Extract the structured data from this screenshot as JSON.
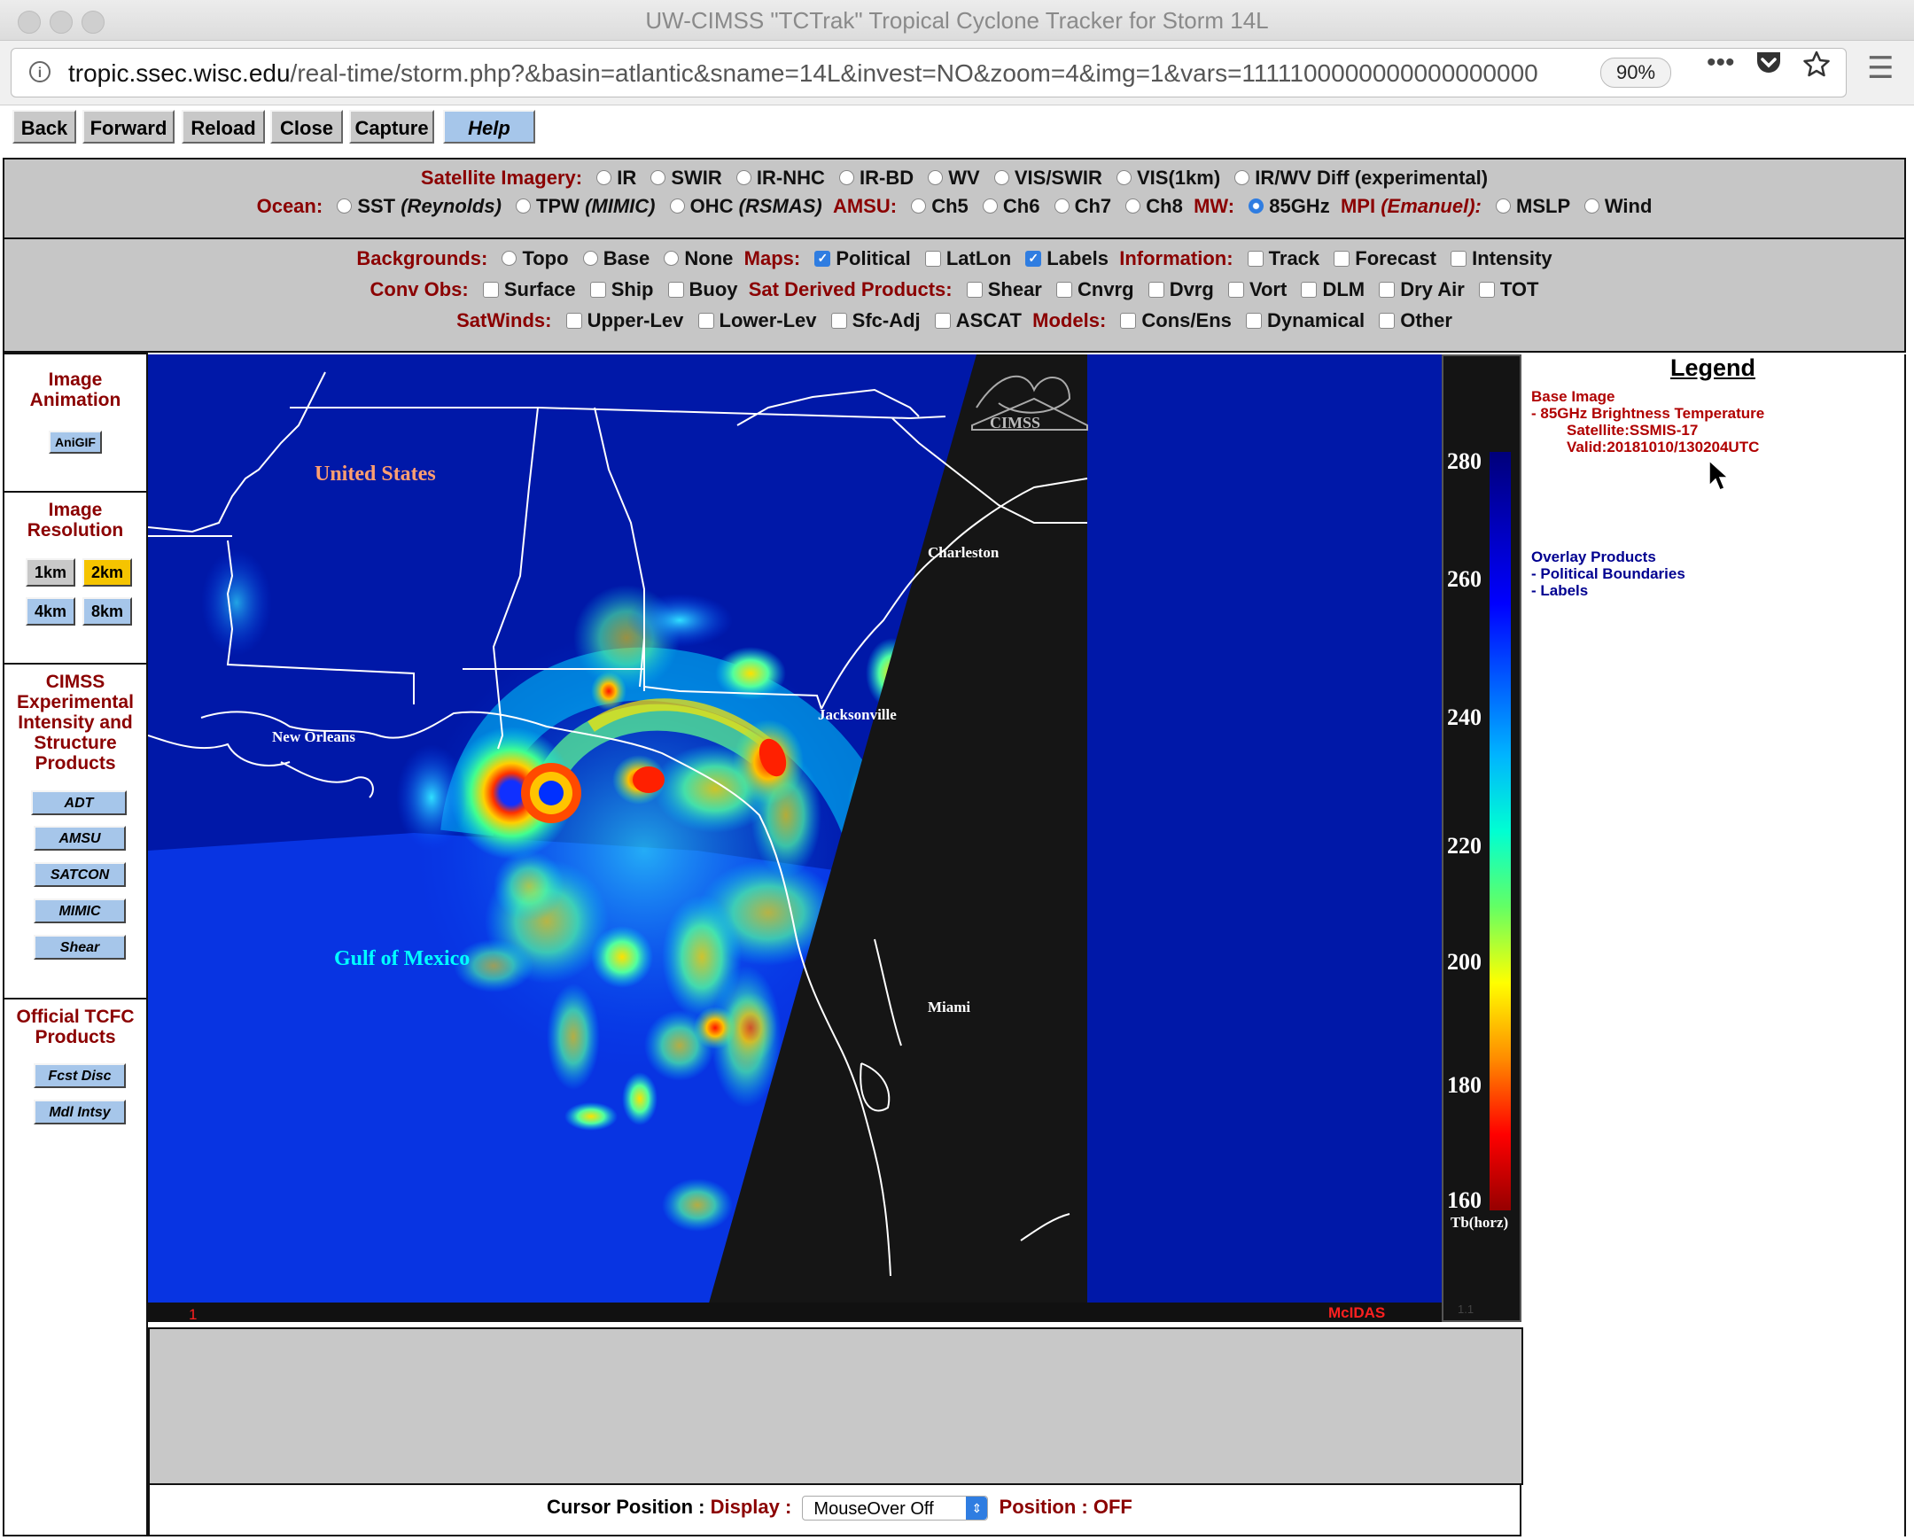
{
  "window": {
    "title": "UW-CIMSS \"TCTrak\" Tropical Cyclone Tracker for Storm 14L"
  },
  "browser": {
    "url_host": "tropic.ssec.wisc.edu",
    "url_path": "/real-time/storm.php?&basin=atlantic&sname=14L&invest=NO&zoom=4&img=1&vars=1111100000000000000000",
    "zoom": "90%",
    "icons": [
      "info-icon",
      "more-icon",
      "pocket-icon",
      "bookmark-star-icon",
      "hamburger-menu-icon"
    ]
  },
  "nav": {
    "back": "Back",
    "forward": "Forward",
    "reload": "Reload",
    "close": "Close",
    "capture": "Capture",
    "help": "Help"
  },
  "sat": {
    "label": "Satellite Imagery:",
    "options": [
      "IR",
      "SWIR",
      "IR-NHC",
      "IR-BD",
      "WV",
      "VIS/SWIR",
      "VIS(1km)",
      "IR/WV Diff (experimental)"
    ]
  },
  "ocean": {
    "label": "Ocean:",
    "sst": "SST",
    "sst_src": "(Reynolds)",
    "tpw": "TPW",
    "tpw_src": "(MIMIC)",
    "ohc": "OHC",
    "ohc_src": "(RSMAS)",
    "amsu_label": "AMSU:",
    "ch5": "Ch5",
    "ch6": "Ch6",
    "ch7": "Ch7",
    "ch8": "Ch8",
    "mw_label": "MW:",
    "mw_opt": "85GHz",
    "mw_selected": true,
    "mpi_label": "MPI",
    "mpi_src": "(Emanuel):",
    "mslp": "MSLP",
    "wind": "Wind"
  },
  "bg": {
    "label": "Backgrounds:",
    "topo": "Topo",
    "base": "Base",
    "none": "None"
  },
  "maps": {
    "label": "Maps:",
    "political": "Political",
    "political_checked": true,
    "latlon": "LatLon",
    "labels": "Labels",
    "labels_checked": true
  },
  "info": {
    "label": "Information:",
    "track": "Track",
    "forecast": "Forecast",
    "intensity": "Intensity"
  },
  "conv": {
    "label": "Conv Obs:",
    "surface": "Surface",
    "ship": "Ship",
    "buoy": "Buoy"
  },
  "satder": {
    "label": "Sat Derived Products:",
    "shear": "Shear",
    "cnvrg": "Cnvrg",
    "dvrg": "Dvrg",
    "vort": "Vort",
    "dlm": "DLM",
    "dryair": "Dry Air",
    "tot": "TOT"
  },
  "satwinds": {
    "label": "SatWinds:",
    "upper": "Upper-Lev",
    "lower": "Lower-Lev",
    "sfc": "Sfc-Adj",
    "ascat": "ASCAT"
  },
  "models": {
    "label": "Models:",
    "cons": "Cons/Ens",
    "dyn": "Dynamical",
    "other": "Other"
  },
  "sidebar": {
    "anim": {
      "title1": "Image",
      "title2": "Animation",
      "anigif": "AniGIF"
    },
    "res": {
      "title1": "Image",
      "title2": "Resolution",
      "r1km": "1km",
      "r2km": "2km",
      "r4km": "4km",
      "r8km": "8km",
      "selected": "2km"
    },
    "cimss": {
      "t1": "CIMSS",
      "t2": "Experimental",
      "t3": "Intensity and",
      "t4": "Structure",
      "t5": "Products",
      "adt": "ADT",
      "amsu": "AMSU",
      "satcon": "SATCON",
      "mimic": "MIMIC",
      "shear": "Shear"
    },
    "tcfc": {
      "t1": "Official TCFC",
      "t2": "Products",
      "fcst": "Fcst Disc",
      "mdl": "Mdl Intsy"
    }
  },
  "map": {
    "labels": {
      "us": "United States",
      "charleston": "Charleston",
      "jacksonville": "Jacksonville",
      "neworleans": "New Orleans",
      "miami": "Miami",
      "gulf": "Gulf of Mexico"
    },
    "frame": "1",
    "mcidas": "McIDAS",
    "logo": "CIMSS",
    "colors": {
      "ocean": "#0018a8",
      "swath_gap": "#151515"
    }
  },
  "colorbar": {
    "ticks": [
      "280",
      "260",
      "240",
      "220",
      "200",
      "180",
      "160"
    ],
    "unit": "Tb(horz)",
    "footer": "1.1"
  },
  "legend": {
    "title": "Legend",
    "base_image": "Base Image",
    "base_item": "-  85GHz Brightness Temperature",
    "satellite": "Satellite:SSMIS-17",
    "valid": "Valid:20181010/130204UTC",
    "overlay": "Overlay Products",
    "overlay_items": [
      "-  Political Boundaries",
      "-  Labels"
    ]
  },
  "cursor": {
    "label": "Cursor Position :",
    "display_label": "Display :",
    "select_value": "MouseOver Off",
    "position_label": "Position :",
    "position_value": "OFF"
  }
}
